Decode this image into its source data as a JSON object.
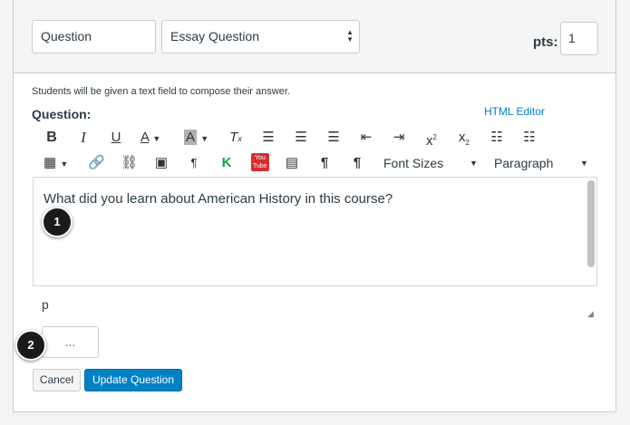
{
  "header": {
    "question_name": "Question",
    "question_type": "Essay Question",
    "pts_label": "pts:",
    "pts_value": "1"
  },
  "body": {
    "hint": "Students will be given a text field to compose their answer.",
    "question_label": "Question:",
    "html_editor_link": "HTML Editor"
  },
  "toolbar": {
    "font_sizes_label": "Font Sizes",
    "paragraph_label": "Paragraph"
  },
  "editor": {
    "content": "What did you learn about American History in this course?",
    "path_label": "p"
  },
  "more_box": {
    "label": "..."
  },
  "callouts": {
    "one": "1",
    "two": "2"
  },
  "buttons": {
    "cancel": "Cancel",
    "update": "Update Question"
  }
}
